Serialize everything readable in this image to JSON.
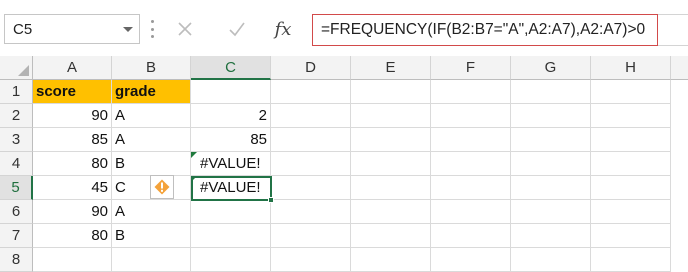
{
  "name_box": {
    "value": "C5"
  },
  "formula_bar": {
    "cancel_icon": "close-icon",
    "enter_icon": "check-icon",
    "fx_label": "fx",
    "formula": "=FREQUENCY(IF(B2:B7=\"A\",A2:A7),A2:A7)>0"
  },
  "columns": [
    "A",
    "B",
    "C",
    "D",
    "E",
    "F",
    "G",
    "H"
  ],
  "rows": [
    "1",
    "2",
    "3",
    "4",
    "5",
    "6",
    "7",
    "8"
  ],
  "selected_column": "C",
  "selected_row": "5",
  "cells": {
    "A1": "score",
    "B1": "grade",
    "A2": "90",
    "B2": "A",
    "C2": "2",
    "A3": "85",
    "B3": "A",
    "C3": "85",
    "A4": "80",
    "B4": "B",
    "C4": "#VALUE!",
    "A5": "45",
    "B5": "C",
    "C5": "#VALUE!",
    "A6": "90",
    "B6": "A",
    "A7": "80",
    "B7": "B"
  },
  "colors": {
    "header_fill": "#ffc000",
    "selection": "#217346",
    "formula_border": "#d24a4a",
    "warning": "#f4a23a"
  },
  "error_indicator_icon": "warning-icon"
}
